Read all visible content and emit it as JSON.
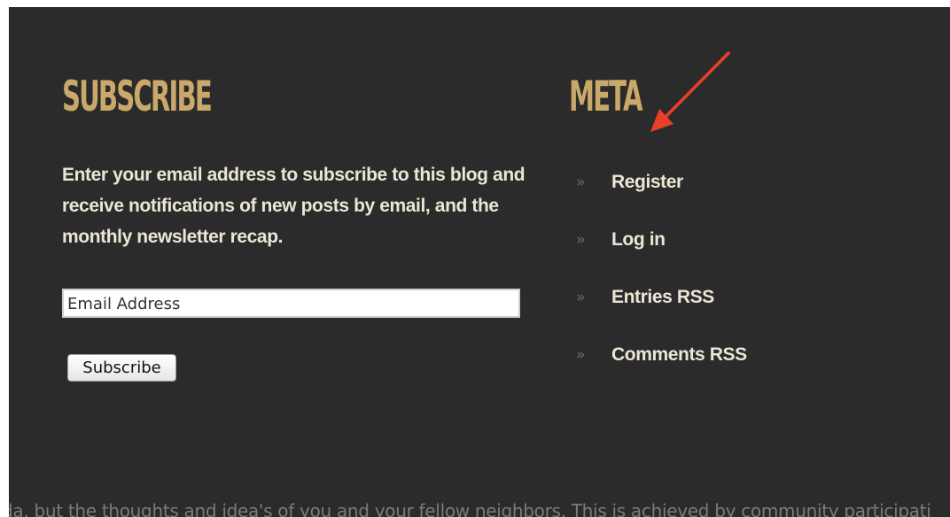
{
  "subscribe": {
    "heading": "SUBSCRIBE",
    "intro": "Enter your email address to subscribe to this blog and receive notifications of new posts by email, and the monthly newsletter recap.",
    "email_placeholder": "Email Address",
    "button_label": "Subscribe"
  },
  "meta": {
    "heading": "META",
    "items": [
      {
        "label": "Register"
      },
      {
        "label": "Log in"
      },
      {
        "label": "Entries RSS"
      },
      {
        "label": "Comments RSS"
      }
    ]
  },
  "footer": {
    "text": "da, but the thoughts and idea's of you and your fellow neighbors. This is achieved by community participati"
  },
  "colors": {
    "background": "#2b2b2b",
    "heading": "#c9a86a",
    "text": "#ece6d6",
    "annotation_arrow": "#e8402a"
  },
  "icons": {
    "list_bullet": "double-chevron-right-icon",
    "annotation": "red-arrow-icon"
  }
}
